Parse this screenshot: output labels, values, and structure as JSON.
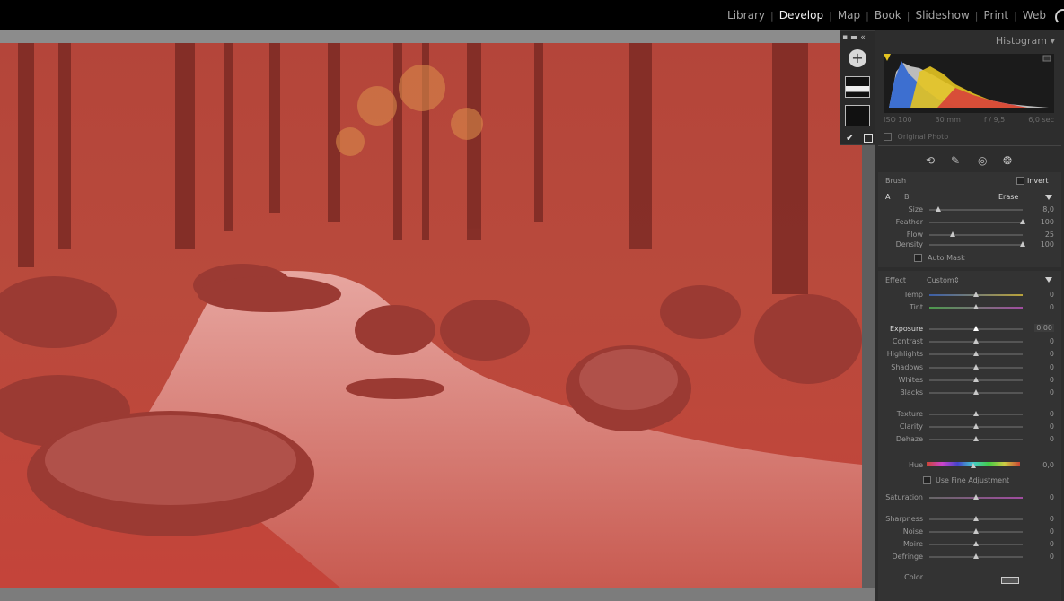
{
  "modules": [
    {
      "label": "Library",
      "active": false
    },
    {
      "label": "Develop",
      "active": true
    },
    {
      "label": "Map",
      "active": false
    },
    {
      "label": "Book",
      "active": false
    },
    {
      "label": "Slideshow",
      "active": false
    },
    {
      "label": "Print",
      "active": false
    },
    {
      "label": "Web",
      "active": false
    }
  ],
  "histogram": {
    "title": "Histogram",
    "iso": "ISO 100",
    "focal": "30 mm",
    "aperture": "f / 9,5",
    "shutter": "6,0 sec",
    "original_photo_label": "Original Photo"
  },
  "brush": {
    "title": "Brush",
    "invert_label": "Invert",
    "a_label": "A",
    "b_label": "B",
    "erase_label": "Erase",
    "size_label": "Size",
    "size_value": "8,0",
    "size_level": 0.1,
    "feather_label": "Feather",
    "feather_value": "100",
    "feather_level": 1.0,
    "flow_label": "Flow",
    "flow_value": "25",
    "flow_level": 0.25,
    "density_label": "Density",
    "density_value": "100",
    "density_level": 1.0,
    "auto_mask_label": "Auto Mask"
  },
  "effect": {
    "title": "Effect",
    "preset": "Custom",
    "temp_label": "Temp",
    "temp_value": "0",
    "tint_label": "Tint",
    "tint_value": "0",
    "exposure_label": "Exposure",
    "exposure_value": "0,00",
    "contrast_label": "Contrast",
    "contrast_value": "0",
    "highlights_label": "Highlights",
    "highlights_value": "0",
    "shadows_label": "Shadows",
    "shadows_value": "0",
    "whites_label": "Whites",
    "whites_value": "0",
    "blacks_label": "Blacks",
    "blacks_value": "0",
    "texture_label": "Texture",
    "texture_value": "0",
    "clarity_label": "Clarity",
    "clarity_value": "0",
    "dehaze_label": "Dehaze",
    "dehaze_value": "0",
    "hue_label": "Hue",
    "hue_value": "0,0",
    "fine_adjust_label": "Use Fine Adjustment",
    "saturation_label": "Saturation",
    "saturation_value": "0",
    "sharpness_label": "Sharpness",
    "sharpness_value": "0",
    "noise_label": "Noise",
    "noise_value": "0",
    "moire_label": "Moire",
    "moire_value": "0",
    "defringe_label": "Defringe",
    "defringe_value": "0",
    "color_label": "Color"
  },
  "colors": {
    "overlay": "#c0392b",
    "panel_bg": "#2d2d2d",
    "top_bar": "#000000"
  }
}
